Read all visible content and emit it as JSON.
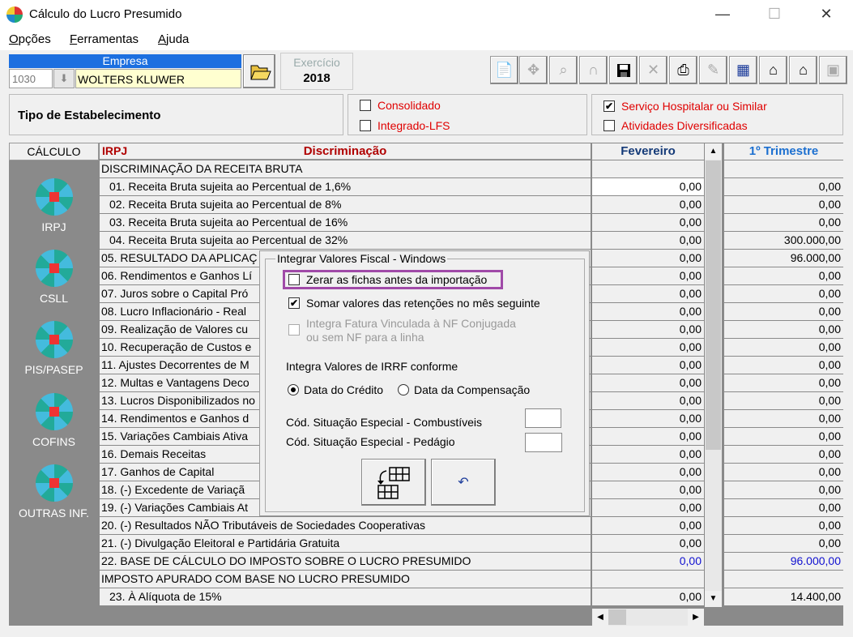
{
  "window": {
    "title": "Cálculo do Lucro Presumido",
    "minimize": "—",
    "maximize": "☐",
    "close": "✕"
  },
  "menu": [
    {
      "label": "Opções",
      "key": "O",
      "rest": "pções"
    },
    {
      "label": "Ferramentas",
      "key": "F",
      "rest": "erramentas"
    },
    {
      "label": "Ajuda",
      "key": "A",
      "rest": "juda"
    }
  ],
  "empresa": {
    "header": "Empresa",
    "code": "1030",
    "name": "WOLTERS KLUWER"
  },
  "exercicio": {
    "label": "Exercício",
    "value": "2018"
  },
  "toolbar_icons": [
    "document-icon",
    "move-icon",
    "search-icon",
    "magnet-icon",
    "save-icon",
    "delete-icon",
    "print-icon",
    "edit-icon",
    "calculator-icon",
    "import-icon",
    "export-icon",
    "archive-icon"
  ],
  "tipo": {
    "label": "Tipo de Estabelecimento"
  },
  "options_left": [
    {
      "label": "Consolidado",
      "checked": false
    },
    {
      "label": "Integrado-LFS",
      "checked": false
    }
  ],
  "options_right": [
    {
      "label": "Serviço Hospitalar ou Similar",
      "checked": true
    },
    {
      "label": "Atividades Diversificadas",
      "checked": false
    }
  ],
  "nav": {
    "header": "CÁLCULO",
    "items": [
      "IRPJ",
      "CSLL",
      "PIS/PASEP",
      "COFINS",
      "OUTRAS INF."
    ]
  },
  "grid": {
    "header_key": "IRPJ",
    "header_title": "Discriminação",
    "month": "Fevereiro",
    "quarter": "1º Trimestre",
    "rows": [
      {
        "label": "DISCRIMINAÇÃO DA RECEITA BRUTA",
        "m": "",
        "t": ""
      },
      {
        "label": "01. Receita Bruta sujeita ao Percentual de 1,6%",
        "m": "0,00",
        "t": "0,00",
        "sub": true
      },
      {
        "label": "02. Receita Bruta sujeita ao Percentual de 8%",
        "m": "0,00",
        "t": "0,00",
        "sub": true
      },
      {
        "label": "03. Receita Bruta sujeita ao Percentual de 16%",
        "m": "0,00",
        "t": "0,00",
        "sub": true
      },
      {
        "label": "04. Receita Bruta sujeita ao Percentual de 32%",
        "m": "0,00",
        "t": "300.000,00",
        "sub": true
      },
      {
        "label": "05. RESULTADO DA APLICAÇ",
        "m": "0,00",
        "t": "96.000,00"
      },
      {
        "label": "06. Rendimentos e Ganhos Lí",
        "m": "0,00",
        "t": "0,00"
      },
      {
        "label": "07. Juros sobre o Capital Pró",
        "m": "0,00",
        "t": "0,00"
      },
      {
        "label": "08. Lucro Inflacionário - Real",
        "m": "0,00",
        "t": "0,00"
      },
      {
        "label": "09. Realização de Valores cu",
        "m": "0,00",
        "t": "0,00"
      },
      {
        "label": "10. Recuperação de Custos e",
        "m": "0,00",
        "t": "0,00"
      },
      {
        "label": "11. Ajustes Decorrentes de M",
        "m": "0,00",
        "t": "0,00"
      },
      {
        "label": "12. Multas e Vantagens Deco",
        "m": "0,00",
        "t": "0,00"
      },
      {
        "label": "13. Lucros Disponibilizados no",
        "m": "0,00",
        "t": "0,00"
      },
      {
        "label": "14. Rendimentos e Ganhos d",
        "m": "0,00",
        "t": "0,00"
      },
      {
        "label": "15. Variações Cambiais Ativa",
        "m": "0,00",
        "t": "0,00"
      },
      {
        "label": "16. Demais Receitas",
        "m": "0,00",
        "t": "0,00"
      },
      {
        "label": "17. Ganhos de Capital",
        "m": "0,00",
        "t": "0,00"
      },
      {
        "label": "18. (-) Excedente de Variaçã",
        "m": "0,00",
        "t": "0,00"
      },
      {
        "label": "19. (-) Variações Cambiais At",
        "m": "0,00",
        "t": "0,00"
      },
      {
        "label": "20. (-) Resultados NÃO Tributáveis de Sociedades Cooperativas",
        "m": "0,00",
        "t": "0,00"
      },
      {
        "label": "21. (-) Divulgação Eleitoral e Partidária Gratuita",
        "m": "0,00",
        "t": "0,00"
      },
      {
        "label": "22. BASE DE CÁLCULO DO IMPOSTO SOBRE O LUCRO PRESUMIDO",
        "m": "0,00",
        "t": "96.000,00",
        "blue": true
      },
      {
        "label": "IMPOSTO APURADO COM BASE NO LUCRO PRESUMIDO",
        "m": "",
        "t": ""
      },
      {
        "label": "23. À Alíquota de 15%",
        "m": "0,00",
        "t": "14.400,00",
        "sub": true
      }
    ]
  },
  "dialog": {
    "title": "Integrar Valores Fiscal - Windows",
    "zerar": "Zerar as fichas antes da importação",
    "somar": "Somar valores das retenções no mês seguinte",
    "integra_fatura_1": "Integra Fatura Vinculada à NF Conjugada",
    "integra_fatura_2": "ou sem NF para a linha",
    "irrf_label": "Integra Valores de IRRF conforme",
    "radio_credito": "Data do Crédito",
    "radio_compensacao": "Data da Compensação",
    "combustiveis_label": "Cód. Situação Especial - Combustíveis",
    "combustiveis_value": "",
    "pedagio_label": "Cód. Situação Especial - Pedágio",
    "pedagio_value": "",
    "undo_glyph": "↶",
    "check_glyph": "✔"
  }
}
